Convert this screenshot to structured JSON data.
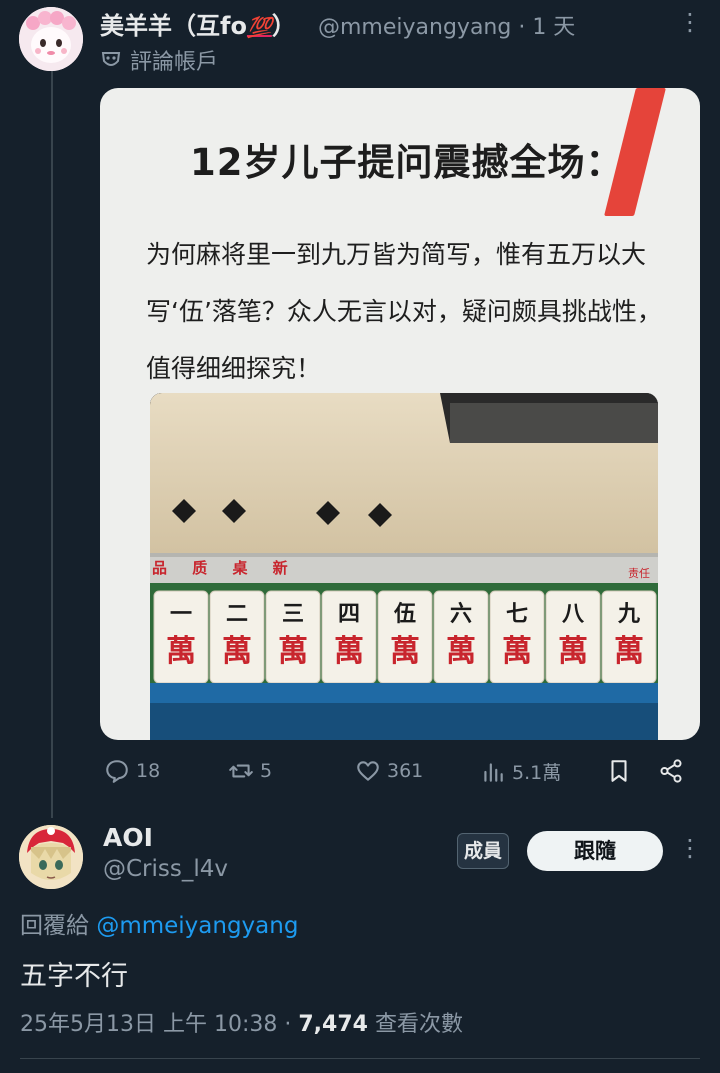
{
  "post": {
    "display_name": "美羊羊（互fo",
    "name_emoji": "💯",
    "name_close": "）",
    "handle": "@mmeiyangyang",
    "time": "· 1 天",
    "account_label": "評論帳戶",
    "media": {
      "title": "12岁儿子提问震撼全场：",
      "body": "为何麻将里一到九万皆为简写，惟有五万以大写‘伍’落笔？众人无言以对，疑问颇具挑战性，值得细细探究！",
      "tiles_top": [
        "一",
        "二",
        "三",
        "四",
        "伍",
        "六",
        "七",
        "八",
        "九"
      ],
      "tile_bottom": "萬",
      "rack_text": "品 质 桌 新",
      "rack_right_text": "责任"
    },
    "stats": {
      "replies": "18",
      "reposts": "5",
      "likes": "361",
      "views": "5.1萬"
    }
  },
  "reply": {
    "name": "AOI",
    "handle": "@Criss_l4v",
    "member_badge": "成員",
    "follow_label": "跟隨",
    "replying_to_label": "回覆給",
    "replying_to_handle": "@mmeiyangyang",
    "text": "五字不行",
    "timestamp": "25年5月13日 上午 10:38 · ",
    "views_count": "7,474",
    "views_label": " 查看次數"
  },
  "colors": {
    "background": "#15202b",
    "accent": "#1d9bf0",
    "muted": "#8b98a5",
    "tile_red": "#c8252d"
  }
}
